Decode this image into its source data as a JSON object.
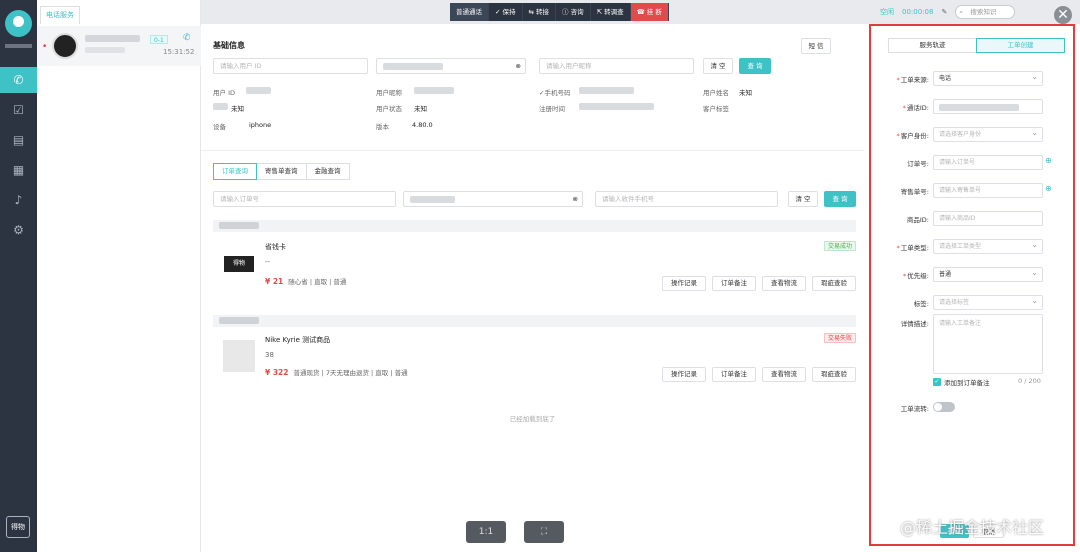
{
  "session": {
    "tab": "电话服务",
    "badge": "0-1",
    "time": "15:31:52"
  },
  "sidebar": {
    "bottom_label": "得物"
  },
  "callbar": {
    "normal": "普通通话",
    "hold": "✓ 保持",
    "transfer": "⇆ 转接",
    "consult": "ⓘ 咨询",
    "survey": "⇱ 转调查",
    "hangup": "☎ 挂 断"
  },
  "topright": {
    "status": "空闲",
    "timer": "00:00:08",
    "search_placeholder": "搜索知识"
  },
  "basic": {
    "title": "基础信息",
    "sms_button": "短 信",
    "user_id_placeholder": "请输入用户 ID",
    "nickname_placeholder": "请输入用户昵称",
    "clear": "清 空",
    "query": "查 询",
    "fields": {
      "user_id": "用户 ID",
      "nickname": "用户昵称",
      "phone": "✓手机号码",
      "realname": "用户姓名",
      "realname_value": "未知",
      "unknown1": "未知",
      "user_status": "用户状态",
      "user_status_value": "未知",
      "register_time": "注册时间",
      "customer_tag": "客户标签",
      "device": "设备",
      "device_value": "iphone",
      "version": "版本",
      "version_value": "4.80.0"
    }
  },
  "order_tabs": [
    "订单查询",
    "寄售单查询",
    "金融查询"
  ],
  "order_search": {
    "order_placeholder": "请输入订单号",
    "receiver_placeholder": "请输入收件手机号",
    "clear": "清 空",
    "query": "查 询"
  },
  "orders": [
    {
      "title": "省钱卡",
      "spec": "--",
      "price": "¥ 21",
      "tags": "随心省 | 直取 | 普通",
      "state": "交易成功",
      "actions": [
        "操作记录",
        "订单备注",
        "查看物流",
        "瑕疵查验"
      ]
    },
    {
      "title": "Nike Kyrie 测试商品",
      "spec": "38",
      "price": "¥ 322",
      "tags": "普通现货 | 7天无理由退货 | 直取 | 普通",
      "state": "交易失败",
      "actions": [
        "操作记录",
        "订单备注",
        "查看物流",
        "瑕疵查验"
      ]
    }
  ],
  "no_more": "已经加载到底了",
  "bottom_tools": [
    "1:1",
    "⛶"
  ],
  "right": {
    "tabs": [
      "服务轨迹",
      "工单创建"
    ],
    "fields": [
      {
        "label": "工单来源:",
        "req": true,
        "value": "电话",
        "type": "select"
      },
      {
        "label": "通话ID:",
        "req": true,
        "value": "",
        "type": "blur"
      },
      {
        "label": "客户身份:",
        "req": true,
        "value": "请选择客户身份",
        "type": "select"
      },
      {
        "label": "订单号:",
        "req": false,
        "value": "请输入订单号",
        "type": "input"
      },
      {
        "label": "寄售单号:",
        "req": false,
        "value": "请输入寄售单号",
        "type": "input"
      },
      {
        "label": "商品ID:",
        "req": false,
        "value": "请输入商品ID",
        "type": "input"
      },
      {
        "label": "工单类型:",
        "req": true,
        "value": "请选择工单类型",
        "type": "select"
      },
      {
        "label": "优先级:",
        "req": true,
        "value": "普通",
        "type": "select"
      },
      {
        "label": "标签:",
        "req": false,
        "value": "请选择标签",
        "type": "select"
      }
    ],
    "detail_label": "详情描述:",
    "detail_placeholder": "请输入工单备注",
    "add_note": "添加到订单备注",
    "counter": "0 / 200",
    "flow_label": "工单流转:",
    "submit": "提交",
    "cancel": "取消"
  },
  "watermark": "@稀土掘金技术社区"
}
